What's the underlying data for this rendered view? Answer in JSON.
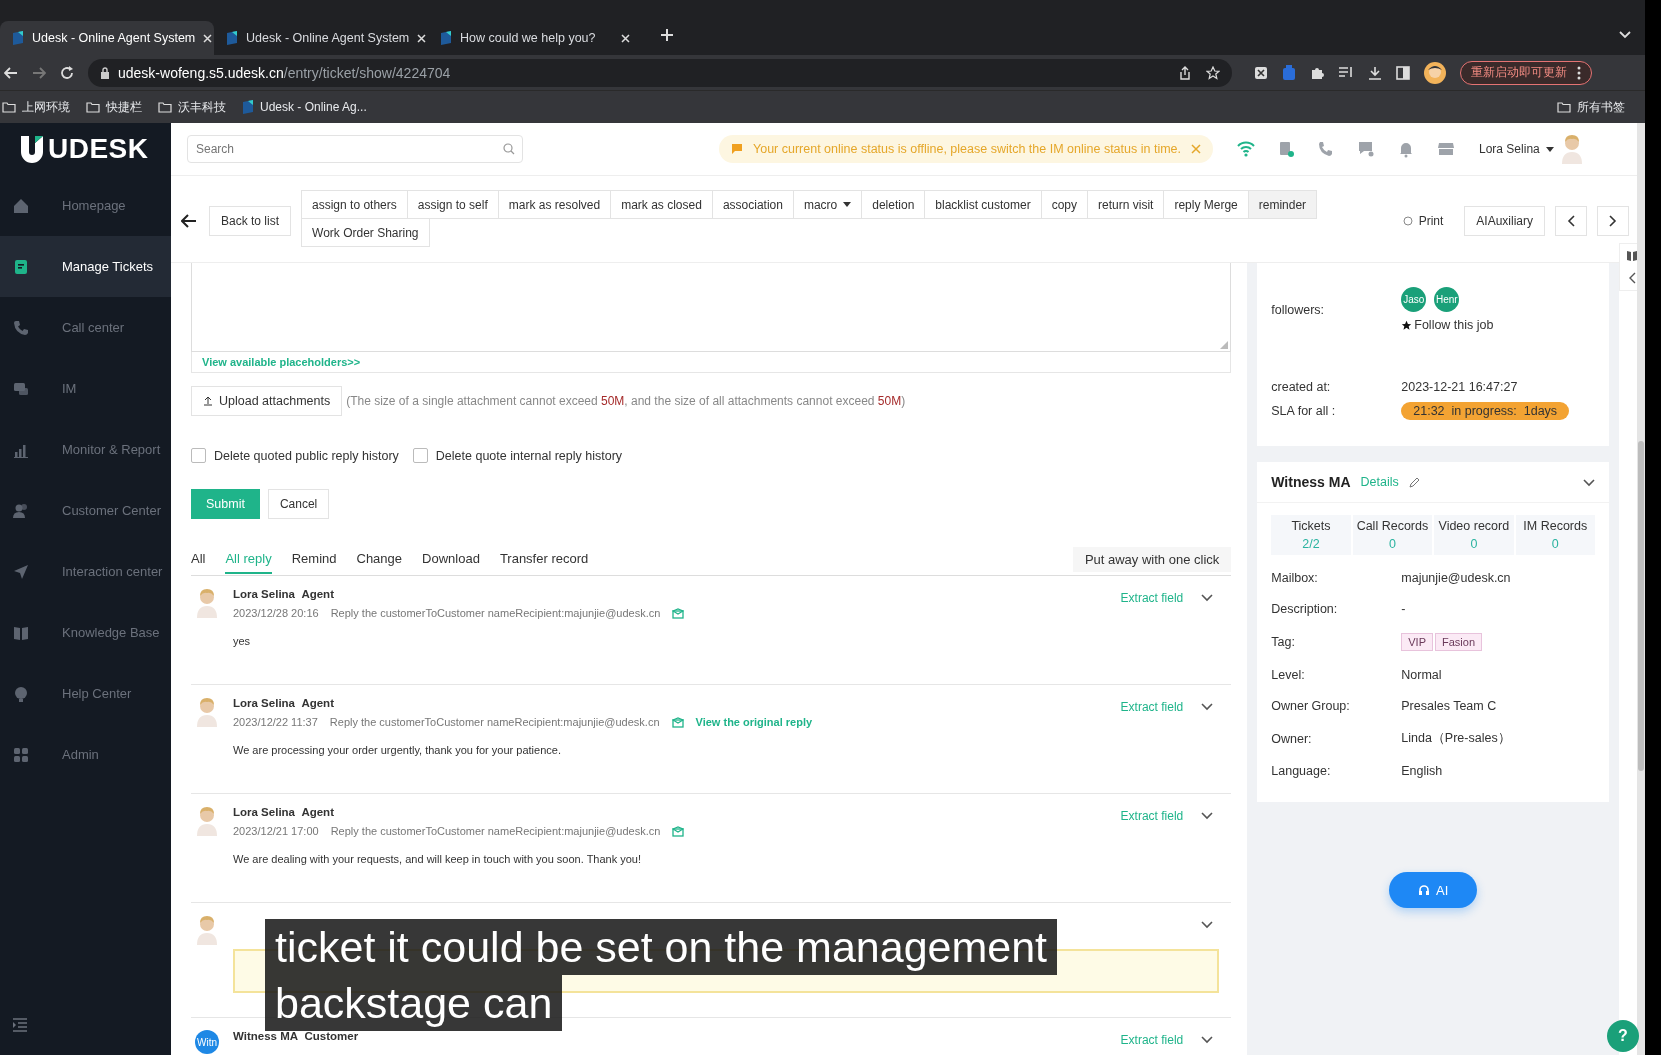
{
  "browser": {
    "tabs": [
      {
        "title": "Udesk - Online Agent System",
        "selected": true
      },
      {
        "title": "Udesk - Online Agent System",
        "selected": false
      },
      {
        "title": "How could we help you?",
        "selected": false
      }
    ],
    "url_host": "udesk-wofeng.s5.udesk.cn",
    "url_path": "/entry/ticket/show/4224704",
    "update_button": "重新启动即可更新",
    "bookmarks": [
      {
        "label": "上网环境",
        "kind": "folder"
      },
      {
        "label": "快捷栏",
        "kind": "folder"
      },
      {
        "label": "沃丰科技",
        "kind": "folder"
      },
      {
        "label": "Udesk - Online Ag...",
        "kind": "site"
      }
    ],
    "all_bookmarks": "所有书签"
  },
  "sidebar": {
    "logo": "UDESK",
    "items": [
      {
        "label": "Homepage",
        "selected": false
      },
      {
        "label": "Manage Tickets",
        "selected": true
      },
      {
        "label": "Call center",
        "selected": false
      },
      {
        "label": "IM",
        "selected": false
      },
      {
        "label": "Monitor & Report",
        "selected": false
      },
      {
        "label": "Customer Center",
        "selected": false
      },
      {
        "label": "Interaction center",
        "selected": false
      },
      {
        "label": "Knowledge Base",
        "selected": false
      },
      {
        "label": "Help Center",
        "selected": false
      },
      {
        "label": "Admin",
        "selected": false
      }
    ]
  },
  "header": {
    "search": {
      "placeholder": "Search"
    },
    "notice": "Your current online status is offline, please switch the IM online status in time.",
    "user": "Lora Selina"
  },
  "toolbar": {
    "back": "Back to list",
    "actions": [
      {
        "label": "assign to others",
        "kind": "button",
        "highlighted": false
      },
      {
        "label": "assign to self",
        "kind": "button",
        "highlighted": false
      },
      {
        "label": "mark as resolved",
        "kind": "button",
        "highlighted": false
      },
      {
        "label": "mark as closed",
        "kind": "button",
        "highlighted": false
      },
      {
        "label": "association",
        "kind": "button",
        "highlighted": false
      },
      {
        "label": "macro",
        "kind": "dropdown",
        "highlighted": false
      },
      {
        "label": "deletion",
        "kind": "button",
        "highlighted": false
      },
      {
        "label": "blacklist customer",
        "kind": "button",
        "highlighted": false
      },
      {
        "label": "copy",
        "kind": "button",
        "highlighted": false
      },
      {
        "label": "return visit",
        "kind": "button",
        "highlighted": false
      },
      {
        "label": "reply Merge",
        "kind": "button",
        "highlighted": false
      },
      {
        "label": "reminder",
        "kind": "button",
        "highlighted": true
      },
      {
        "label": "Work Order Sharing",
        "kind": "button",
        "highlighted": false
      }
    ],
    "print": "Print",
    "ai_auxiliary": "AIAuxiliary"
  },
  "reply_form": {
    "placeholders_link": "View available placeholders>>",
    "upload": "Upload attachments",
    "upload_note": [
      {
        "text": "(The size of a single attachment cannot exceed ",
        "highlight": false
      },
      {
        "text": "50M",
        "highlight": true
      },
      {
        "text": ", and the size of all attachments cannot exceed ",
        "highlight": false
      },
      {
        "text": "50M",
        "highlight": true
      },
      {
        "text": ")",
        "highlight": false
      }
    ],
    "options": [
      {
        "label": "Delete quoted public reply history",
        "checked": false
      },
      {
        "label": "Delete quote internal reply history",
        "checked": false
      }
    ],
    "submit": "Submit",
    "cancel": "Cancel"
  },
  "history": {
    "tabs": [
      {
        "label": "All",
        "selected": false
      },
      {
        "label": "All reply",
        "selected": true
      },
      {
        "label": "Remind",
        "selected": false
      },
      {
        "label": "Change",
        "selected": false
      },
      {
        "label": "Download",
        "selected": false
      },
      {
        "label": "Transfer record",
        "selected": false
      }
    ],
    "collapse_all": "Put away with one click",
    "replies": [
      {
        "kind": "agent",
        "author": "Lora Selina",
        "role": "Agent",
        "time": "2023/12/28 20:16",
        "meta": "Reply the customerToCustomer nameRecipient:majunjie@udesk.cn",
        "body": "yes",
        "action": "Extract field"
      },
      {
        "kind": "agent",
        "author": "Lora Selina",
        "role": "Agent",
        "time": "2023/12/22 11:37",
        "meta": "Reply the customerToCustomer nameRecipient:majunjie@udesk.cn",
        "link": "View the original reply",
        "body": "We are processing your order urgently, thank you for your patience.",
        "action": "Extract field"
      },
      {
        "kind": "agent",
        "author": "Lora Selina",
        "role": "Agent",
        "time": "2023/12/21 17:00",
        "meta": "Reply the customerToCustomer nameRecipient:majunjie@udesk.cn",
        "body": "We are dealing with your requests, and will keep in touch with you soon. Thank you!",
        "action": "Extract field"
      },
      {
        "kind": "note"
      },
      {
        "kind": "customer",
        "avatar": "Witn",
        "author": "Witness MA",
        "role": "Customer",
        "action": "Extract field"
      }
    ]
  },
  "ticket_info": {
    "followers_label": "followers:",
    "followers": [
      "Jaso",
      "Henr"
    ],
    "follow": "Follow this job",
    "created_label": "created at:",
    "created": "2023-12-21 16:47:27",
    "sla_label": "SLA for all :",
    "sla": "21:32  in progress:  1days"
  },
  "customer": {
    "name": "Witness MA",
    "details": "Details",
    "stats": [
      {
        "label": "Tickets",
        "value": "2/2"
      },
      {
        "label": "Call Records",
        "value": "0"
      },
      {
        "label": "Video record",
        "value": "0"
      },
      {
        "label": "IM Records",
        "value": "0"
      }
    ],
    "fields": [
      {
        "label": "Mailbox:",
        "kind": "text",
        "value": "majunjie@udesk.cn"
      },
      {
        "label": "Description:",
        "kind": "text",
        "value": "-"
      },
      {
        "label": "Tag:",
        "kind": "tags",
        "tags": [
          "VIP",
          "Fasion"
        ]
      },
      {
        "label": "Level:",
        "kind": "text",
        "value": "Normal"
      },
      {
        "label": "Owner Group:",
        "kind": "text",
        "value": "Presales Team C"
      },
      {
        "label": "Owner:",
        "kind": "text",
        "value": "Linda（Pre-sales）"
      },
      {
        "label": "Language:",
        "kind": "text",
        "value": "English"
      }
    ]
  },
  "ai_button": "AI",
  "help_button": "?",
  "caption": {
    "lines": [
      "ticket it could be set on the management",
      "backstage can"
    ]
  }
}
